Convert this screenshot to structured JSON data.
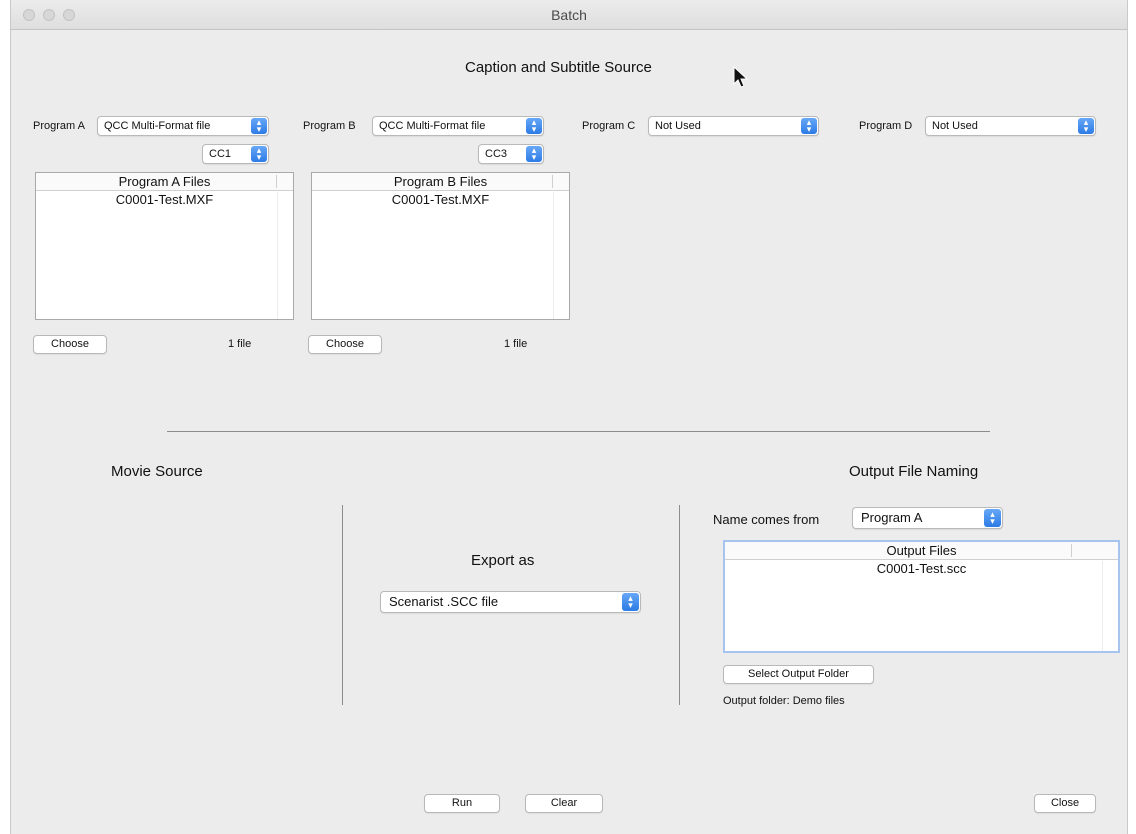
{
  "window": {
    "title": "Batch"
  },
  "caption_section": {
    "heading": "Caption and Subtitle Source"
  },
  "programs": [
    {
      "label": "Program A",
      "source": "QCC Multi-Format file",
      "channel": "CC1",
      "list_header": "Program A Files",
      "files": [
        "C0001-Test.MXF"
      ],
      "choose_label": "Choose",
      "count": "1 file"
    },
    {
      "label": "Program B",
      "source": "QCC Multi-Format file",
      "channel": "CC3",
      "list_header": "Program B Files",
      "files": [
        "C0001-Test.MXF"
      ],
      "choose_label": "Choose",
      "count": "1 file"
    },
    {
      "label": "Program C",
      "source": "Not Used"
    },
    {
      "label": "Program D",
      "source": "Not Used"
    }
  ],
  "movie_source": {
    "heading": "Movie Source"
  },
  "export": {
    "heading": "Export as",
    "format": "Scenarist .SCC file"
  },
  "output_naming": {
    "heading": "Output File Naming",
    "name_from_label": "Name comes from",
    "name_from_value": "Program A",
    "list_header": "Output Files",
    "files": [
      "C0001-Test.scc"
    ],
    "select_folder_label": "Select Output Folder",
    "folder_text": "Output folder: Demo files"
  },
  "footer": {
    "run_label": "Run",
    "clear_label": "Clear",
    "close_label": "Close"
  },
  "icons": {
    "stepper": "up-down-chevron-icon",
    "cursor": "mouse-pointer-icon"
  },
  "colors": {
    "accent": "#2c7be5",
    "focus_ring": "#a7c4ee",
    "window_bg": "#ececec"
  }
}
